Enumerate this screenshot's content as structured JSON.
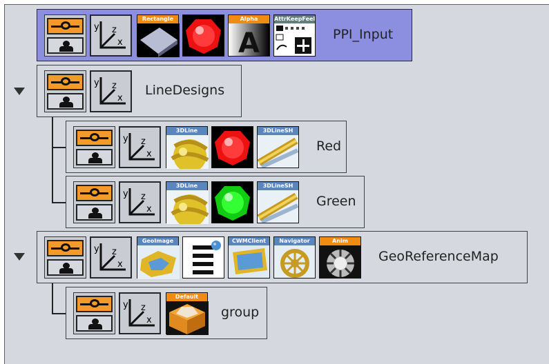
{
  "tree": {
    "nodes": [
      {
        "label": "PPI_Input",
        "plugins": [
          "Rectangle",
          "Alpha",
          "AttrKeepFeel"
        ],
        "selected": true
      },
      {
        "label": "LineDesigns",
        "expanded": true,
        "plugins": []
      },
      {
        "label": "Red",
        "plugins": [
          "3DLine",
          "3DLineSH"
        ],
        "material_color": "#ee1111"
      },
      {
        "label": "Green",
        "plugins": [
          "3DLine",
          "3DLineSH"
        ],
        "material_color": "#11dd11"
      },
      {
        "label": "GeoReferenceMap",
        "expanded": true,
        "plugins": [
          "GeoImage",
          "CWMClient",
          "Navigator",
          "Anim"
        ]
      },
      {
        "label": "group",
        "plugins": [
          "Default"
        ]
      }
    ]
  },
  "axes_icon": {
    "y": "y",
    "z": "z",
    "x": "x"
  },
  "colors": {
    "panel": "#d5d8df",
    "selected": "#8c8ee0",
    "accent": "#f39a2a"
  }
}
